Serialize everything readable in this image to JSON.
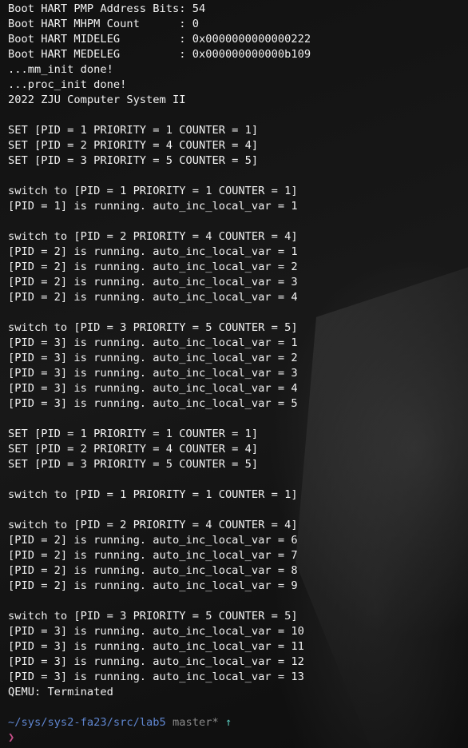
{
  "terminal": {
    "lines": [
      "Boot HART PMP Address Bits: 54",
      "Boot HART MHPM Count      : 0",
      "Boot HART MIDELEG         : 0x0000000000000222",
      "Boot HART MEDELEG         : 0x000000000000b109",
      "...mm_init done!",
      "...proc_init done!",
      "2022 ZJU Computer System II",
      "",
      "SET [PID = 1 PRIORITY = 1 COUNTER = 1]",
      "SET [PID = 2 PRIORITY = 4 COUNTER = 4]",
      "SET [PID = 3 PRIORITY = 5 COUNTER = 5]",
      "",
      "switch to [PID = 1 PRIORITY = 1 COUNTER = 1]",
      "[PID = 1] is running. auto_inc_local_var = 1",
      "",
      "switch to [PID = 2 PRIORITY = 4 COUNTER = 4]",
      "[PID = 2] is running. auto_inc_local_var = 1",
      "[PID = 2] is running. auto_inc_local_var = 2",
      "[PID = 2] is running. auto_inc_local_var = 3",
      "[PID = 2] is running. auto_inc_local_var = 4",
      "",
      "switch to [PID = 3 PRIORITY = 5 COUNTER = 5]",
      "[PID = 3] is running. auto_inc_local_var = 1",
      "[PID = 3] is running. auto_inc_local_var = 2",
      "[PID = 3] is running. auto_inc_local_var = 3",
      "[PID = 3] is running. auto_inc_local_var = 4",
      "[PID = 3] is running. auto_inc_local_var = 5",
      "",
      "SET [PID = 1 PRIORITY = 1 COUNTER = 1]",
      "SET [PID = 2 PRIORITY = 4 COUNTER = 4]",
      "SET [PID = 3 PRIORITY = 5 COUNTER = 5]",
      "",
      "switch to [PID = 1 PRIORITY = 1 COUNTER = 1]",
      "",
      "switch to [PID = 2 PRIORITY = 4 COUNTER = 4]",
      "[PID = 2] is running. auto_inc_local_var = 6",
      "[PID = 2] is running. auto_inc_local_var = 7",
      "[PID = 2] is running. auto_inc_local_var = 8",
      "[PID = 2] is running. auto_inc_local_var = 9",
      "",
      "switch to [PID = 3 PRIORITY = 5 COUNTER = 5]",
      "[PID = 3] is running. auto_inc_local_var = 10",
      "[PID = 3] is running. auto_inc_local_var = 11",
      "[PID = 3] is running. auto_inc_local_var = 12",
      "[PID = 3] is running. auto_inc_local_var = 13",
      "QEMU: Terminated",
      ""
    ],
    "prompt": {
      "path": "~/sys/sys2-fa23/src/lab5",
      "branch": "master*",
      "status_symbol": "↑",
      "caret": "❯"
    },
    "colors": {
      "text": "#f2f2f2",
      "path": "#5f86d0",
      "branch": "#8a8a8a",
      "status_symbol": "#57c4b8",
      "caret": "#c8508a"
    }
  }
}
